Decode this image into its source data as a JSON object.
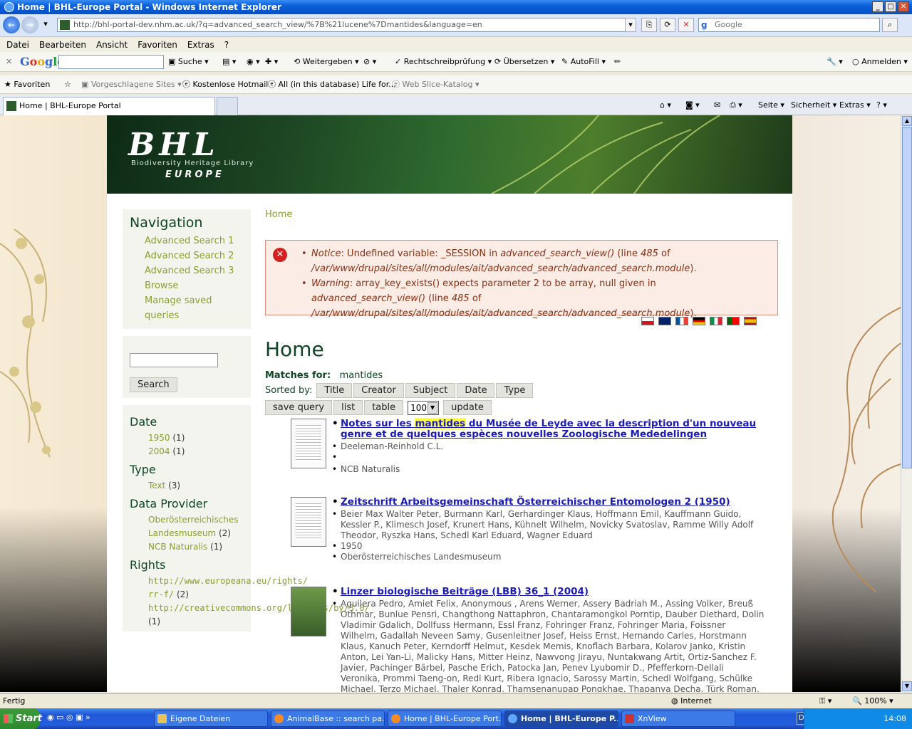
{
  "window": {
    "title": "Home | BHL-Europe Portal - Windows Internet Explorer"
  },
  "address": {
    "url": "http://bhl-portal-dev.nhm.ac.uk/?q=advanced_search_view/%7B%21lucene%7Dmantides&language=en",
    "search_placeholder": "Google"
  },
  "menu": [
    "Datei",
    "Bearbeiten",
    "Ansicht",
    "Favoriten",
    "Extras",
    "?"
  ],
  "google_toolbar": {
    "logo": "Google",
    "items": [
      "Suche",
      "Weitergeben",
      "Rechtschreibprüfung",
      "Übersetzen",
      "AutoFill",
      "Anmelden"
    ]
  },
  "favorites_bar": {
    "label": "Favoriten",
    "items": [
      "Vorgeschlagene Sites",
      "Kostenlose Hotmail",
      "All (in this database) Life for...",
      "Web Slice-Katalog"
    ]
  },
  "tabs": {
    "active": "Home | BHL-Europe Portal"
  },
  "command_bar": [
    "Seite",
    "Sicherheit",
    "Extras"
  ],
  "banner": {
    "logo": "BHL",
    "subtitle": "Biodiversity Heritage Library",
    "region": "EUROPE"
  },
  "sidebar": {
    "nav_title": "Navigation",
    "nav_items": [
      "Advanced Search 1",
      "Advanced Search 2",
      "Advanced Search 3",
      "Browse",
      "Manage saved queries"
    ],
    "search_button": "Search",
    "facets": [
      {
        "title": "Date",
        "items": [
          {
            "label": "1950",
            "count": "(1)"
          },
          {
            "label": "2004",
            "count": "(1)"
          }
        ]
      },
      {
        "title": "Type",
        "items": [
          {
            "label": "Text",
            "count": "(3)"
          }
        ]
      },
      {
        "title": "Data Provider",
        "items": [
          {
            "label": "Oberösterreichisches Landesmuseum",
            "count": "(2)"
          },
          {
            "label": "NCB Naturalis",
            "count": "(1)"
          }
        ]
      },
      {
        "title": "Rights",
        "items": [
          {
            "label": "http://www.europeana.eu/rights/rr-f/",
            "count": "(2)"
          },
          {
            "label": "http://creativecommons.org/licenses/by/3.0/",
            "count": "(1)"
          }
        ]
      }
    ]
  },
  "main": {
    "breadcrumb": "Home",
    "messages": [
      {
        "type": "Notice",
        "text_a": ": Undefined variable: _SESSION in ",
        "func": "advanced_search_view()",
        "text_b": " (line ",
        "line": "485",
        "text_c": " of ",
        "path": "/var/www/drupal/sites/all/modules/ait/advanced_search/advanced_search.module",
        "text_d": ")."
      },
      {
        "type": "Warning",
        "text_a": ": array_key_exists() expects parameter 2 to be array, null given in ",
        "func": "advanced_search_view()",
        "text_b": " (line ",
        "line": "485",
        "text_c": " of ",
        "path": "/var/www/drupal/sites/all/modules/ait/advanced_search/advanced_search.module",
        "text_d": ")."
      }
    ],
    "page_title": "Home",
    "matches_label": "Matches for:",
    "matches_term": "mantides",
    "sorted_by_label": "Sorted by:",
    "sort_buttons": [
      "Title",
      "Creator",
      "Subject",
      "Date",
      "Type"
    ],
    "tool_buttons": {
      "save_query": "save query",
      "list": "list",
      "table": "table",
      "per_page": "100",
      "update": "update"
    },
    "results": [
      {
        "title_pre": "Notes sur les ",
        "title_hl": "mantides",
        "title_post": " du Musée de Leyde avec la description d'un nouveau genre et de quelques espèces nouvelles Zoologische Mededelingen",
        "lines": [
          "Deeleman-Reinhold C.L.",
          "",
          "NCB Naturalis"
        ]
      },
      {
        "title_pre": "Zeitschrift Arbeitsgemeinschaft Österreichischer Entomologen 2 (1950)",
        "title_hl": "",
        "title_post": "",
        "lines": [
          "Beier Max Walter Peter, Burmann Karl, Gerhardinger Klaus, Hoffmann Emil, Kauffmann Guido, Kessler P., Klimesch Josef, Krunert Hans, Kühnelt Wilhelm, Novicky Svatoslav, Ramme Willy Adolf Theodor, Ryszka Hans, Schedl Karl Eduard, Wagner Eduard",
          "1950",
          "Oberösterreichisches Landesmuseum"
        ]
      },
      {
        "title_pre": "Linzer biologische Beiträge (LBB) 36_1 (2004)",
        "title_hl": "",
        "title_post": "",
        "lines": [
          "Aguilera Pedro, Amiet Felix, Anonymous , Arens Werner, Assery Badriah M., Assing Volker, Breuß Othmar, Bunlue Pensri, Changthong Nattaphron, Chantaramongkol Porntip, Dauber Diethard, Dolin Vladimir Gdalich, Dollfuss Hermann, Essl Franz, Fohringer Franz, Fohringer Maria, Foissner Wilhelm, Gadallah Neveen Samy, Gusenleitner Josef, Heiss Ernst, Hernando Carles, Horstmann Klaus, Kanuch Peter, Kerndorff Helmut, Kesdek Memis, Knoflach Barbara, Kolarov Janko, Kristin Anton, Lei Yan-Li, Malicky Hans, Mitter Heinz, Nawvong Jirayu, Nuntakwang Artit, Ortiz-Sanchez F. Javier, Pachinger Bärbel, Pasche Erich, Patocka Jan, Penev Lyubomir D., Pfefferkorn-Dellali Veronika, Prommi Taeng-on, Redl Kurt, Ribera Ignacio, Sarossy Martin, Schedl Wolfgang, Schülke Michael, Terzo Michael, Thaler Konrad, Thamsenanupap Pongkhae, Thapanya Decha, Türk Roman, Vöth Walter, Westrich"
        ]
      }
    ]
  },
  "status": {
    "text": "Fertig",
    "zone": "Internet",
    "zoom": "100%"
  },
  "taskbar": {
    "start": "Start",
    "tasks": [
      "Eigene Dateien",
      "AnimalBase :: search pa...",
      "Home | BHL-Europe Port...",
      "Home | BHL-Europe P...",
      "XnView"
    ],
    "lang": "DE",
    "clock": "14:08"
  },
  "colors": {
    "accent_green": "#0f4525",
    "link_green": "#87a02a",
    "title_link_blue": "#1b1bb8",
    "error_text": "#8b2f12"
  }
}
